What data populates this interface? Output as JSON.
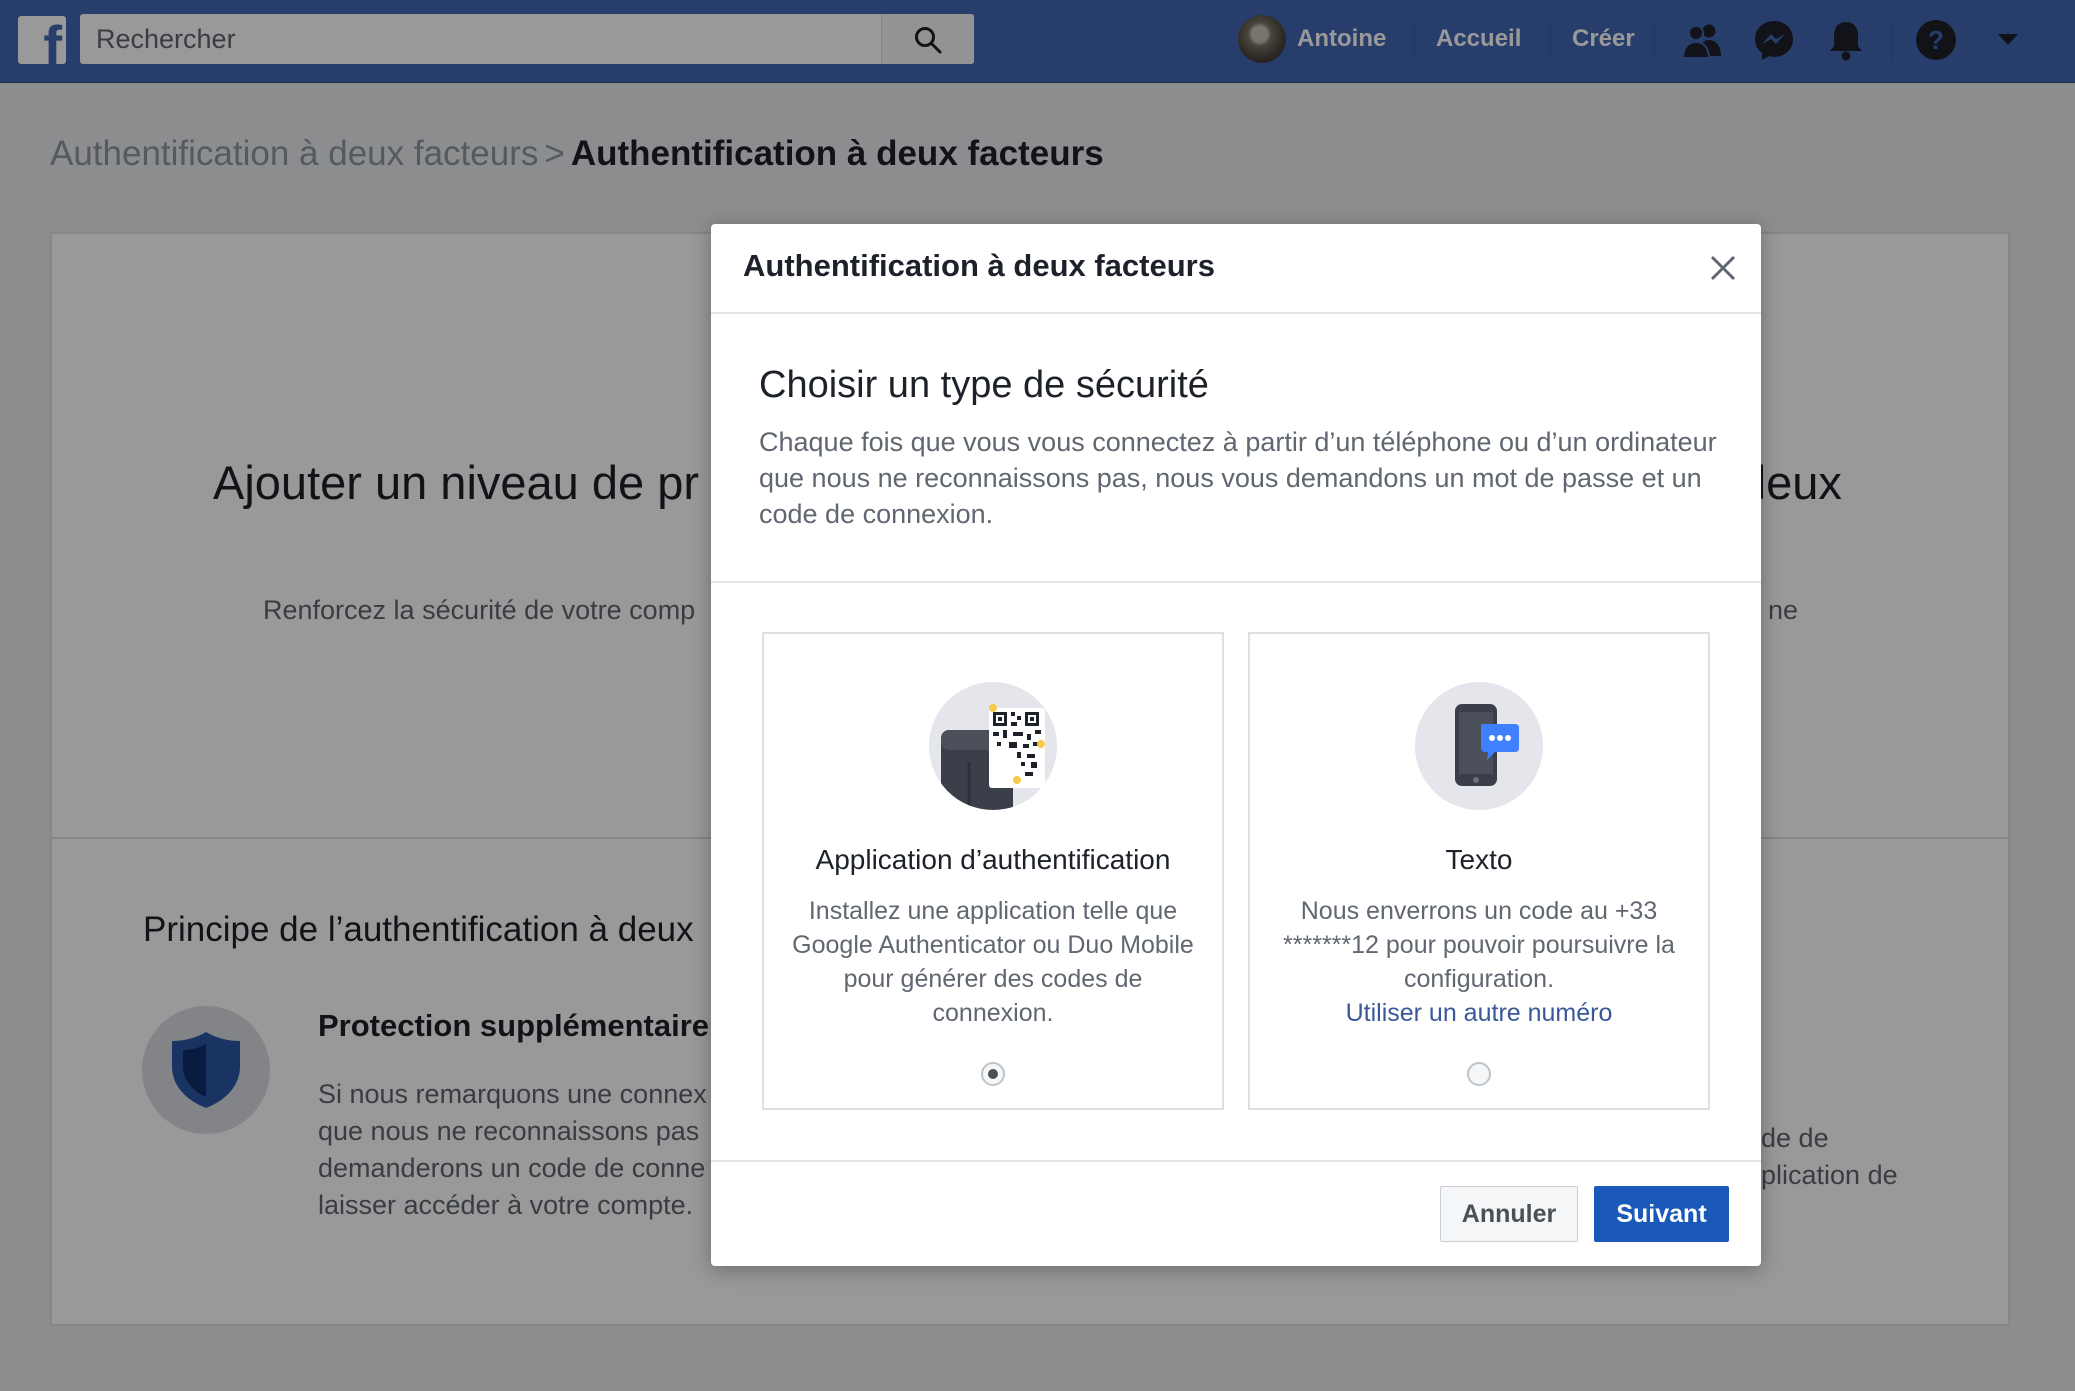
{
  "topbar": {
    "logo": "f",
    "search_placeholder": "Rechercher",
    "user_name": "Antoine",
    "home": "Accueil",
    "create": "Créer",
    "icons": [
      "friends-icon",
      "messenger-icon",
      "notifications-icon",
      "help-icon",
      "dropdown-arrow-icon"
    ],
    "color": "#4267b2"
  },
  "breadcrumb": {
    "parent": "Authentification à deux facteurs",
    "separator": ">",
    "current": "Authentification à deux facteurs"
  },
  "background_page": {
    "hero_title_left": "Ajouter un niveau de pr",
    "hero_title_right": "deux",
    "hero_sub_left": "Renforcez la sécurité de votre comp",
    "hero_sub_right": "ne",
    "how_title": "Principe de l’authentification à deux",
    "protection_title": "Protection supplémentaire",
    "protection_lines": [
      "Si nous remarquons une connex",
      "que nous ne reconnaissons pas",
      "demanderons un code de conne",
      "laisser accéder à votre compte."
    ],
    "right_lines": [
      "ode de",
      "pplication de"
    ]
  },
  "dialog": {
    "title": "Authentification à deux facteurs",
    "heading": "Choisir un type de sécurité",
    "description": "Chaque fois que vous vous connectez à partir d’un téléphone ou d’un ordinateur que nous ne reconnaissons pas, nous vous demandons un mot de passe et un code de connexion.",
    "options": [
      {
        "title": "Application d’authentification",
        "description": "Installez une application telle que Google Authenticator ou Duo Mobile pour générer des codes de connexion.",
        "selected": true
      },
      {
        "title": "Texto",
        "description": "Nous enverrons un code au +33 *******12 pour pouvoir poursuivre la configuration.",
        "link": "Utiliser un autre numéro",
        "selected": false
      }
    ],
    "cancel_label": "Annuler",
    "next_label": "Suivant",
    "primary_color": "#1a58b9"
  }
}
